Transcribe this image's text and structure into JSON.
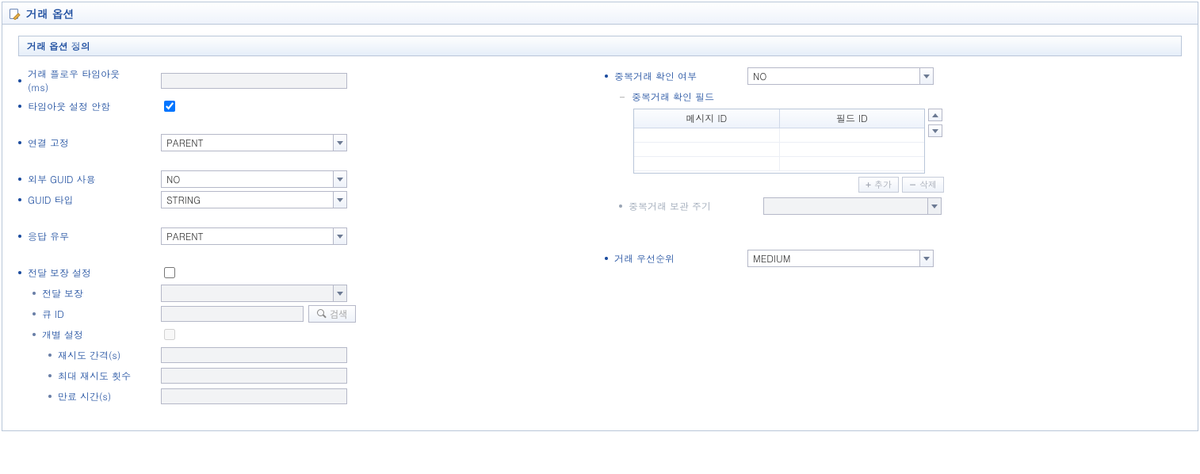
{
  "panel": {
    "title": "거래 옵션"
  },
  "subheader": "거래 옵션 정의",
  "left": {
    "flowTimeout_label": "거래 플로우 타임아웃(ms)",
    "flowTimeout_value": "",
    "noTimeout_label": "타임아웃 설정 안함",
    "noTimeout_checked": true,
    "connFix_label": "연결 고정",
    "connFix_value": "PARENT",
    "extGuid_label": "외부 GUID 사용",
    "extGuid_value": "NO",
    "guidType_label": "GUID 타입",
    "guidType_value": "STRING",
    "respYn_label": "응답 유무",
    "respYn_value": "PARENT",
    "delivSet_label": "전달 보장 설정",
    "delivSet_checked": false,
    "deliv_label": "전달 보장",
    "deliv_value": "",
    "queueId_label": "큐 ID",
    "queueId_value": "",
    "search_label": "검색",
    "indiv_label": "개별 설정",
    "indiv_checked": false,
    "retryInt_label": "재시도 간격(s)",
    "retryInt_value": "",
    "maxRetry_label": "최대 재시도 횟수",
    "maxRetry_value": "",
    "expire_label": "만료 시간(s)",
    "expire_value": ""
  },
  "right": {
    "dupCheck_label": "중복거래 확인 여부",
    "dupCheck_value": "NO",
    "dupField_label": "중복거래 확인 필드",
    "grid": {
      "col1": "메시지 ID",
      "col2": "필드 ID"
    },
    "add_label": "추가",
    "del_label": "삭제",
    "dupRetain_label": "중복거래 보관 주기",
    "dupRetain_value": "",
    "priority_label": "거래 우선순위",
    "priority_value": "MEDIUM"
  }
}
